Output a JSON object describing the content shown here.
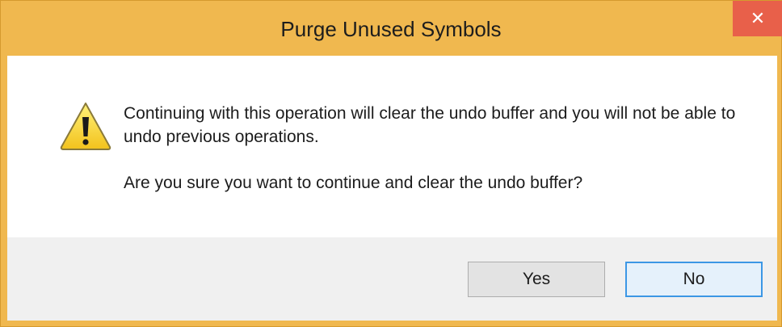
{
  "window": {
    "title": "Purge Unused Symbols",
    "close_icon": "close-icon"
  },
  "dialog": {
    "icon": "warning-icon",
    "message_line1": "Continuing with this operation will clear the undo buffer and you will not be able to undo previous operations.",
    "message_line2": "Are you sure you want to continue and clear the undo buffer?"
  },
  "buttons": {
    "yes": "Yes",
    "no": "No"
  },
  "colors": {
    "title_bar": "#f0b84f",
    "close_button": "#e8604a",
    "default_button_border": "#3c97e5"
  }
}
